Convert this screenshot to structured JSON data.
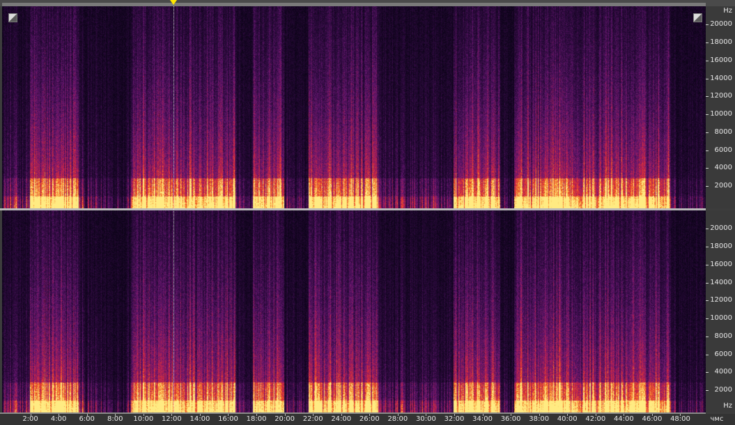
{
  "editor": {
    "view": "spectral-frequency-display",
    "channels": [
      {
        "id": "ch1"
      },
      {
        "id": "ch2"
      }
    ],
    "freq_axis": {
      "unit_label": "Hz",
      "ticks": [
        "20000",
        "18000",
        "16000",
        "14000",
        "12000",
        "10000",
        "8000",
        "6000",
        "4000",
        "2000"
      ]
    },
    "time_axis": {
      "unit_label": "чмс",
      "ticks": [
        "2:00",
        "4:00",
        "6:00",
        "8:00",
        "10:00",
        "12:00",
        "14:00",
        "16:00",
        "18:00",
        "20:00",
        "22:00",
        "24:00",
        "26:00",
        "28:00",
        "30:00",
        "32:00",
        "34:00",
        "36:00",
        "38:00",
        "40:00",
        "42:00",
        "44:00",
        "46:00",
        "48:00"
      ]
    },
    "playhead": {
      "time_minutes": 12.15
    },
    "colors": {
      "background": "#14061f",
      "low": "#2a0a3a",
      "mid": "#7a1a6e",
      "high": "#e0303a",
      "peak": "#ffe070",
      "playhead_marker": "#ffe600"
    }
  }
}
